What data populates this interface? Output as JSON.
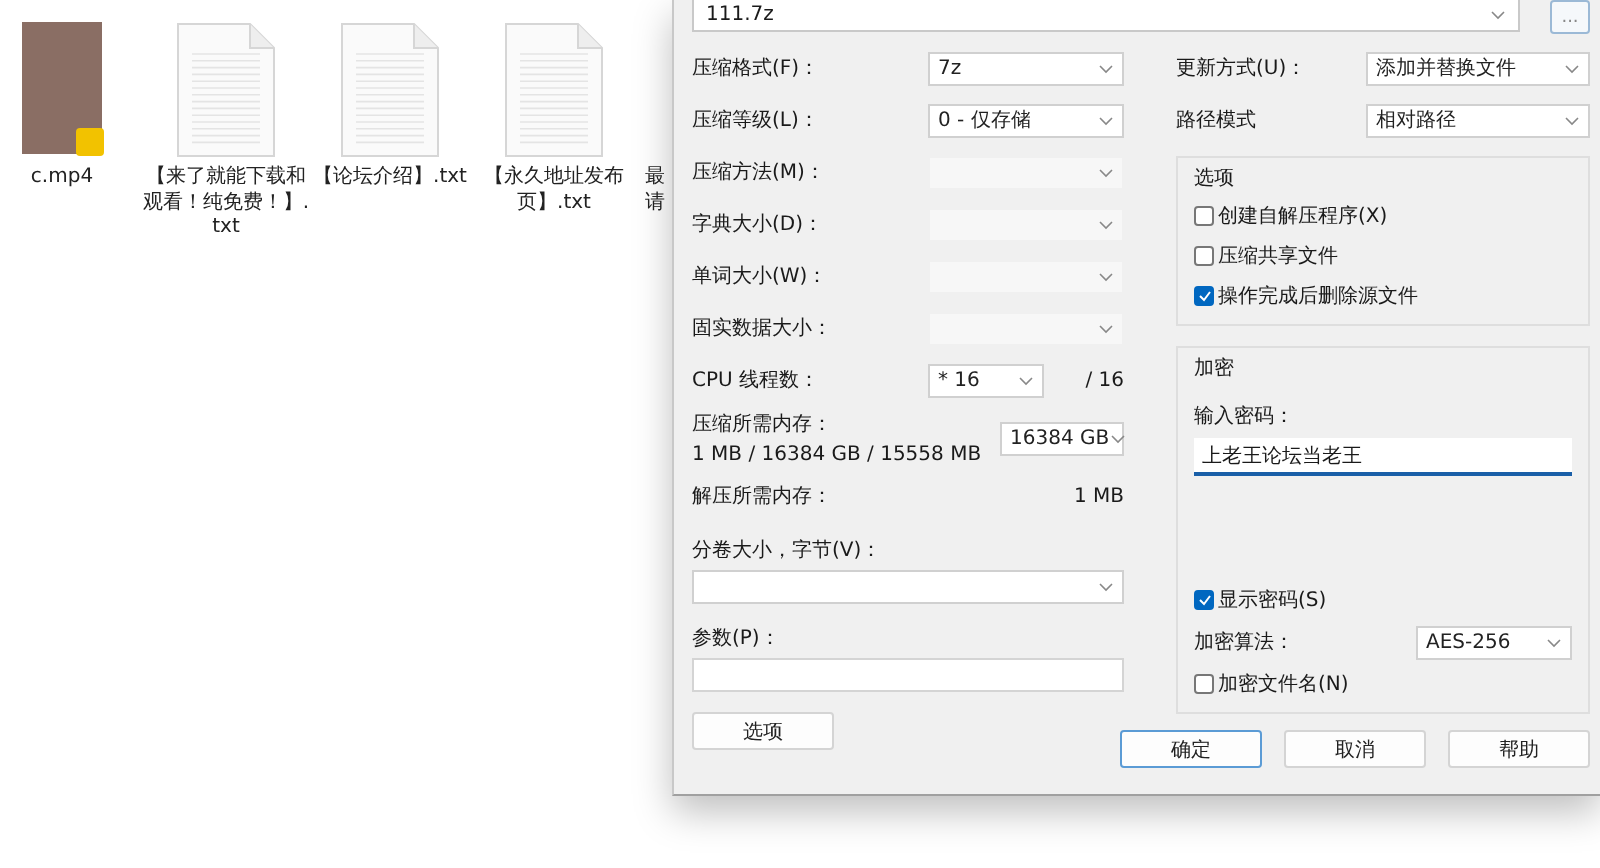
{
  "files": [
    {
      "name": "c.mp4",
      "kind": "video"
    },
    {
      "name": "【来了就能下载和观看！纯免费！】.txt",
      "kind": "text"
    },
    {
      "name": "【论坛介绍】.txt",
      "kind": "text"
    },
    {
      "name": "【永久地址发布页】.txt",
      "kind": "text"
    },
    {
      "name": "最请",
      "kind": "covered"
    }
  ],
  "dialog": {
    "archive": {
      "value": "111.7z",
      "browse": "..."
    },
    "left_rows": [
      {
        "kind": "combo",
        "label": "压缩格式(F)：",
        "value": "7z",
        "disabled": false
      },
      {
        "kind": "combo",
        "label": "压缩等级(L)：",
        "value": "0 - 仅存储",
        "disabled": false
      },
      {
        "kind": "combo",
        "label": "压缩方法(M)：",
        "disabled": true
      },
      {
        "kind": "combo",
        "label": "字典大小(D)：",
        "disabled": true
      },
      {
        "kind": "combo",
        "label": "单词大小(W)：",
        "disabled": true
      },
      {
        "kind": "combo",
        "label": "固实数据大小：",
        "disabled": true
      },
      {
        "kind": "threads",
        "label": "CPU 线程数：",
        "value": "* 16",
        "max": "/ 16"
      },
      {
        "kind": "memory",
        "label": "压缩所需内存：",
        "detail": "1 MB / 16384 GB / 15558 MB",
        "value": "16384 GB"
      },
      {
        "kind": "reading",
        "label": "解压所需内存：",
        "value": "1 MB"
      }
    ],
    "volume": {
      "label": "分卷大小，字节(V)："
    },
    "params": {
      "label": "参数(P)："
    },
    "options_button": "选项",
    "right_rows": [
      {
        "label": "更新方式(U)：",
        "value": "添加并替换文件"
      },
      {
        "label": "路径模式",
        "value": "相对路径"
      }
    ],
    "options_group": {
      "title": "选项",
      "checkboxes": [
        {
          "label": "创建自解压程序(X)",
          "checked": false
        },
        {
          "label": "压缩共享文件",
          "checked": false
        },
        {
          "label": "操作完成后删除源文件",
          "checked": true
        }
      ]
    },
    "encryption": {
      "title": "加密",
      "password_label": "输入密码：",
      "password": "上老王论坛当老王",
      "show_password": {
        "label": "显示密码(S)",
        "checked": true
      },
      "method_label": "加密算法：",
      "method": "AES-256",
      "encrypt_names": {
        "label": "加密文件名(N)",
        "checked": false
      }
    },
    "buttons": [
      {
        "label": "确定",
        "selected": true
      },
      {
        "label": "取消",
        "selected": false
      },
      {
        "label": "帮助",
        "selected": false
      }
    ]
  }
}
